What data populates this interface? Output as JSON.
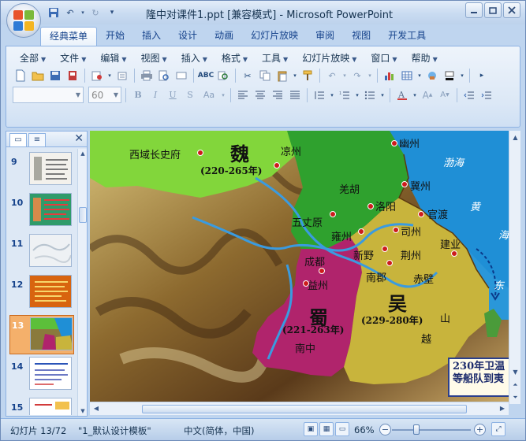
{
  "window": {
    "title": "隆中对课件1.ppt [兼容模式] - Microsoft PowerPoint",
    "minimize_icon": "minimize-icon",
    "restore_icon": "restore-icon",
    "close_icon": "close-icon"
  },
  "ribbon_tabs": [
    "经典菜单",
    "开始",
    "插入",
    "设计",
    "动画",
    "幻灯片放映",
    "审阅",
    "视图",
    "开发工具"
  ],
  "classic_menus": [
    "全部",
    "文件",
    "编辑",
    "视图",
    "插入",
    "格式",
    "工具",
    "幻灯片放映",
    "窗口",
    "帮助"
  ],
  "format_bar": {
    "font_name": "",
    "font_size": "60"
  },
  "slide_thumbnails": [
    {
      "num": "9"
    },
    {
      "num": "10"
    },
    {
      "num": "11"
    },
    {
      "num": "12"
    },
    {
      "num": "13",
      "selected": true
    },
    {
      "num": "14"
    },
    {
      "num": "15"
    }
  ],
  "map": {
    "kingdoms": {
      "wei": "魏",
      "wei_years": "(220-265年)",
      "shu": "蜀",
      "shu_years": "(221-263年)",
      "wu": "吴",
      "wu_years": "(229-280年)"
    },
    "places": {
      "xiyu": "西域长史府",
      "liangzhou": "凉州",
      "youzhou": "幽州",
      "jizhou": "冀州",
      "qiang": "羌胡",
      "luoyang": "洛阳",
      "guandu": "官渡",
      "wuzhangyuan": "五丈原",
      "yongzhou": "雍州",
      "sizhou": "司州",
      "xinye": "新野",
      "jingzhou": "荆州",
      "jianye": "建业",
      "chengdu": "成都",
      "yizhou": "益州",
      "nanjun": "南郡",
      "chibi": "赤壁",
      "nanzhong": "南中",
      "shan": "山",
      "yue": "越"
    },
    "seas": {
      "bohai": "渤海",
      "huang": "黄",
      "hai": "海",
      "dong": "东"
    },
    "callout": {
      "line1": "230年卫温",
      "line2": "等船队到夷"
    }
  },
  "status": {
    "slide_counter": "幻灯片 13/72",
    "template": "\"1_默认设计模板\"",
    "language": "中文(简体，中国)",
    "zoom": "66%"
  },
  "colors": {
    "wei_green": "#2fa12e",
    "shu_magenta": "#b0246c",
    "wu_olive": "#c8b43c",
    "sea_blue": "#1f8fd6",
    "city_dot": "#cc1c1c"
  }
}
